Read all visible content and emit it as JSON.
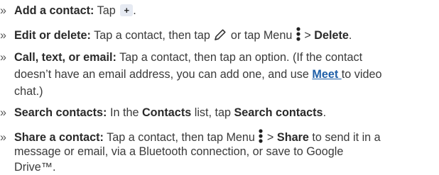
{
  "items": [
    {
      "title": "Add a contact:",
      "text_before": " Tap ",
      "plus_label": "+",
      "text_after": "."
    },
    {
      "title": "Edit or delete:",
      "text_before": " Tap a contact, then tap ",
      "text_mid": " or tap Menu ",
      "sep": " > ",
      "bold_end": "Delete",
      "text_end": "."
    },
    {
      "title": "Call, text, or email:",
      "line1": " Tap a contact, then tap an option. (If the contact",
      "line2_before": "doesn’t have an email address, you can add one, and use ",
      "link": "Meet ",
      "line2_after": "to video",
      "line3": "chat.)"
    },
    {
      "title": "Search contacts:",
      "text_before": " In the ",
      "bold_mid": "Contacts",
      "text_mid": " list, tap ",
      "bold_end": "Search contacts",
      "text_end": "."
    },
    {
      "title": "Share a contact:",
      "text_before": " Tap a contact, then tap Menu ",
      "sep": " > ",
      "bold_mid": "Share",
      "line1_after": " to send it in a",
      "line2": "message or email, via a Bluetooth connection, or save to Google",
      "line3": "Drive™."
    }
  ],
  "bullet": "»",
  "icons": {
    "edit": "pencil-icon",
    "menu": "menu-dots-icon"
  }
}
